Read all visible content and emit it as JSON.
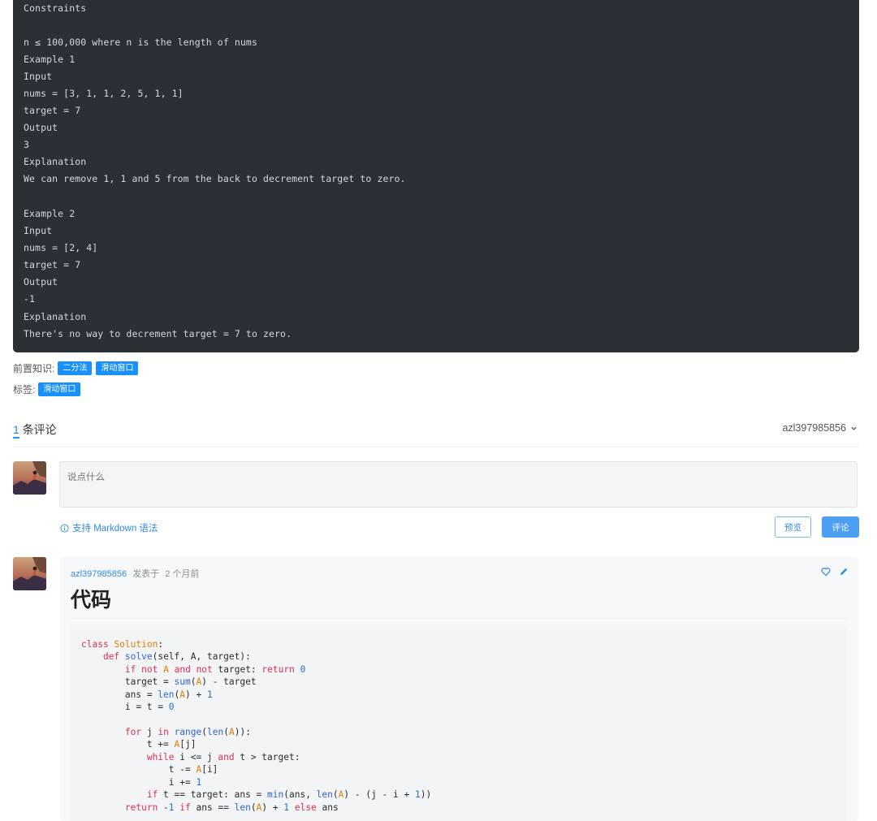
{
  "problem": {
    "lines": [
      "Constraints",
      "",
      "n ≤ 100,000 where n is the length of nums",
      "Example 1",
      "Input",
      "nums = [3, 1, 1, 2, 5, 1, 1]",
      "target = 7",
      "Output",
      "3",
      "Explanation",
      "We can remove 1, 1 and 5 from the back to decrement target to zero.",
      "",
      "Example 2",
      "Input",
      "nums = [2, 4]",
      "target = 7",
      "Output",
      "-1",
      "Explanation",
      "There's no way to decrement target = 7 to zero."
    ]
  },
  "prerequisites": {
    "label": "前置知识:",
    "tags": [
      "二分法",
      "滑动窗口"
    ]
  },
  "labels": {
    "label": "标签:",
    "tags": [
      "滑动窗口"
    ]
  },
  "comments": {
    "count": "1",
    "count_suffix": "条评论",
    "current_user": "azl397985856",
    "input_placeholder": "说点什么",
    "markdown_hint": "支持 Markdown 语法",
    "preview_label": "预览",
    "submit_label": "评论"
  },
  "post": {
    "author": "azl397985856",
    "posted_label": "发表于",
    "time": "2 个月前",
    "title": "代码",
    "code_lines": [
      "class Solution:",
      "    def solve(self, A, target):",
      "        if not A and not target: return 0",
      "        target = sum(A) - target",
      "        ans = len(A) + 1",
      "        i = t = 0",
      "",
      "        for j in range(len(A)):",
      "            t += A[j]",
      "            while i <= j and t > target:",
      "                t -= A[i]",
      "                i += 1",
      "            if t == target: ans = min(ans, len(A) - (j - i + 1))",
      "        return -1 if ans == len(A) + 1 else ans"
    ]
  },
  "colors": {
    "accent": "#1890ff",
    "problem_bg": "#2b2f36",
    "link": "#2f8be0"
  }
}
